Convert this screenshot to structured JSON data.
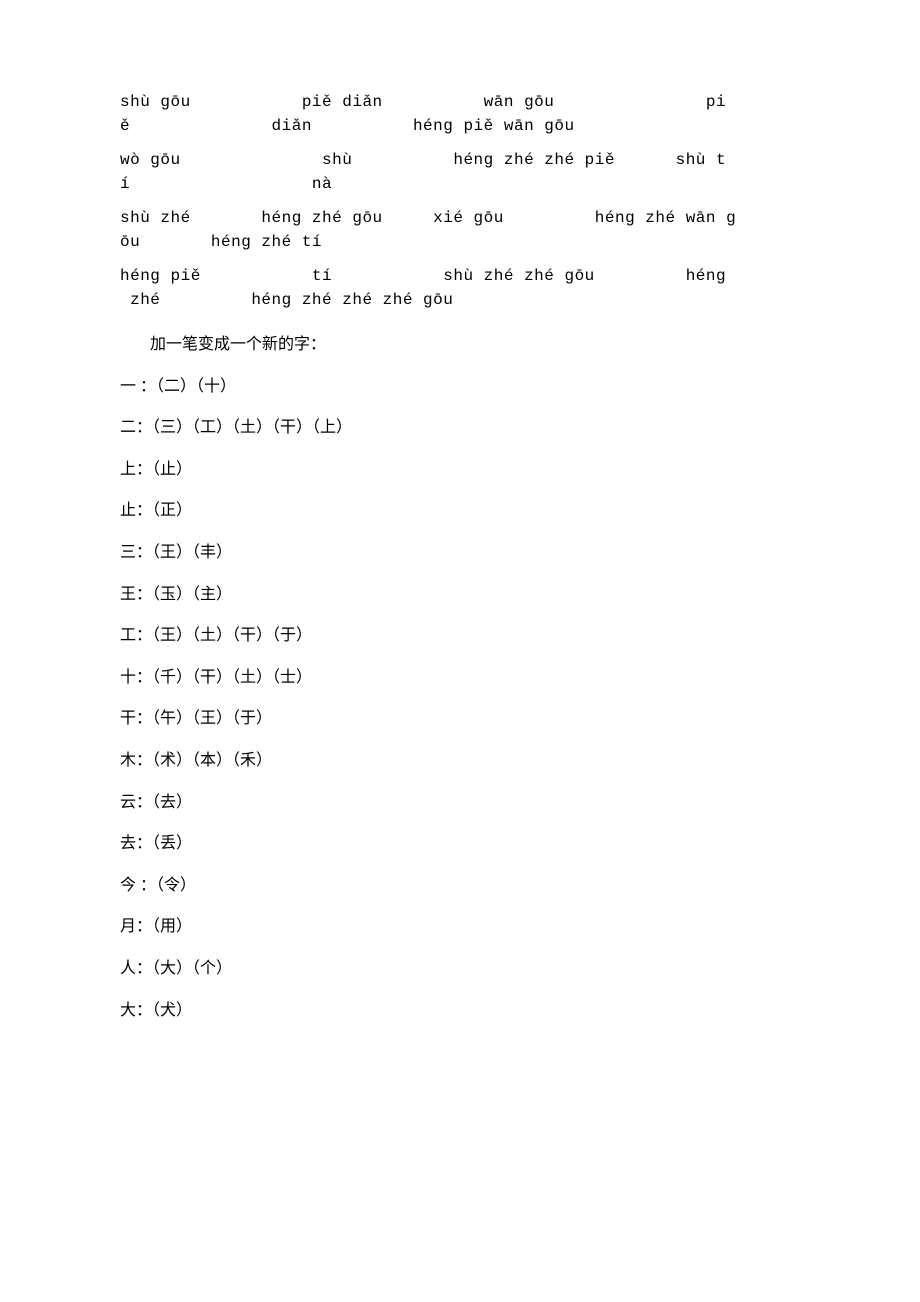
{
  "pinyin": {
    "l1a": "shù gōu           piě diǎn          wān gōu               pi",
    "l1b": "ě              diǎn          héng piě wān gōu",
    "l2a": "wò gōu              shù          héng zhé zhé piě      shù t",
    "l2b": "í                  nà",
    "l3a": "shù zhé       héng zhé gōu     xié gōu         héng zhé wān g",
    "l3b": "ōu       héng zhé tí",
    "l4a": "héng piě           tí           shù zhé zhé gōu         héng",
    "l4b": " zhé         héng zhé zhé zhé gōu"
  },
  "heading": "加一笔变成一个新的字：",
  "rows": {
    "r1": "一 ：（二）（十）",
    "r2": "二：（三）（工）（土）（干）（上）",
    "r3": "上：（止）",
    "r4": "止：（正）",
    "r5": "三：（王）（丰）",
    "r6": "王：（玉）（主）",
    "r7": "工：（王）（土）（干）（于）",
    "r8": "十：（千）（干）（土）（士）",
    "r9": "干：（午）（王）（于）",
    "r10": "木：（术）（本）（禾）",
    "r11": "云：（去）",
    "r12": "去：（丢）",
    "r13": "今 ：（令）",
    "r14": "月：（用）",
    "r15": "人：（大）（个）",
    "r16": "大：（犬）"
  }
}
